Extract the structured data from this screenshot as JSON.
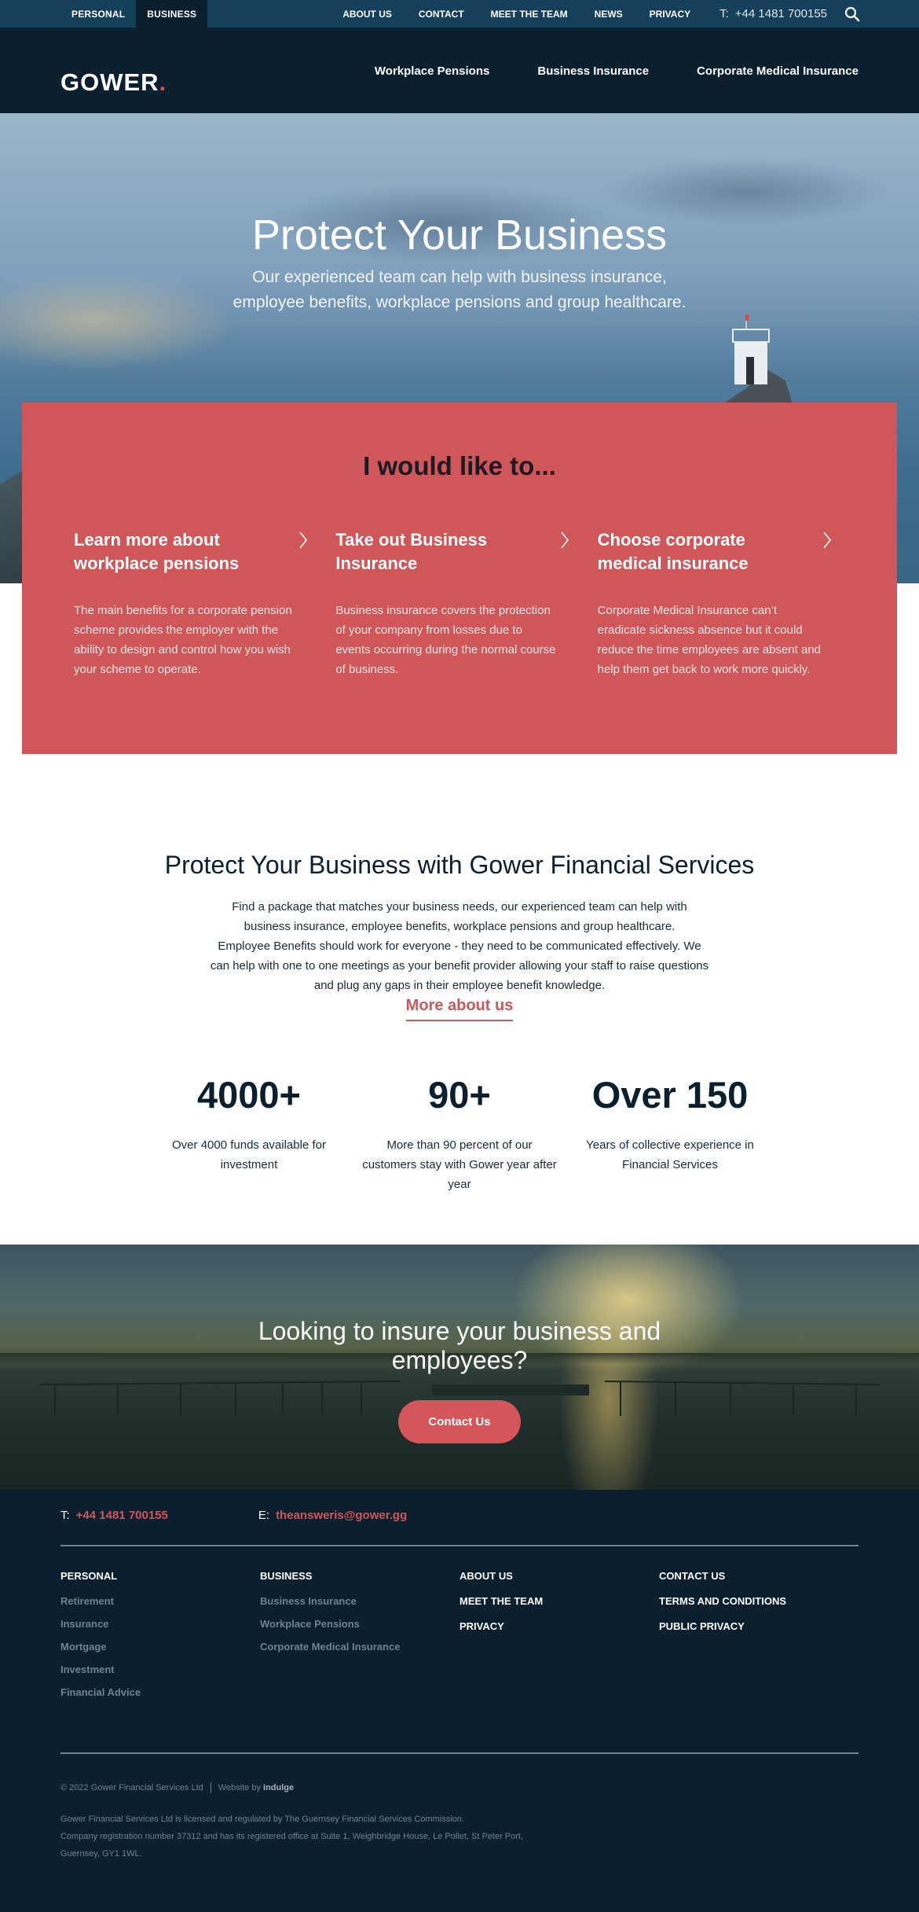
{
  "topbar": {
    "segments": [
      {
        "label": "PERSONAL",
        "active": false
      },
      {
        "label": "BUSINESS",
        "active": true
      }
    ],
    "links": [
      "ABOUT US",
      "CONTACT",
      "MEET THE TEAM",
      "NEWS",
      "PRIVACY"
    ],
    "phone_label": "T:",
    "phone": "+44 1481 700155",
    "search_icon": "search-icon"
  },
  "header": {
    "logo": "GOWER",
    "logo_dot": ".",
    "nav": [
      "Workplace Pensions",
      "Business Insurance",
      "Corporate Medical Insurance"
    ]
  },
  "hero": {
    "title": "Protect Your Business",
    "subtitle_line1": "Our experienced team can help with business insurance,",
    "subtitle_line2": "employee benefits, workplace pensions and group healthcare."
  },
  "panel": {
    "title": "I would like to...",
    "cards": [
      {
        "title": "Learn more about workplace pensions",
        "body": "The main benefits for a corporate pension scheme provides the employer with the ability to design and control how you wish your scheme to operate.",
        "icon": "chevron-right-icon"
      },
      {
        "title": "Take out Business Insurance",
        "body": "Business insurance covers the protection of your company from losses due to events occurring during the normal course of business.",
        "icon": "chevron-right-icon"
      },
      {
        "title": "Choose corporate medical insurance",
        "body": "Corporate Medical Insurance can’t eradicate sickness absence but it could reduce the time employees are absent and help them get back to work more quickly.",
        "icon": "chevron-right-icon"
      }
    ]
  },
  "intro": {
    "heading": "Protect Your Business with Gower Financial Services",
    "para1": "Find a package that matches your business needs, our experienced team can help with business insurance, employee benefits, workplace pensions and group healthcare.",
    "para2": "Employee Benefits should work for everyone - they need to be communicated effectively. We can help with one to one meetings as your benefit provider allowing your staff to raise questions and plug any gaps in their employee benefit knowledge.",
    "link": "More about us"
  },
  "stats": [
    {
      "value": "4000+",
      "desc": "Over 4000 funds available for investment"
    },
    {
      "value": "90+",
      "desc": "More than 90 percent of our customers stay with Gower year after year"
    },
    {
      "value": "Over 150",
      "desc": "Years of collective experience in Financial Services"
    }
  ],
  "cta": {
    "line1": "Looking to insure your business and",
    "line2": "employees?",
    "button": "Contact Us"
  },
  "footer": {
    "phone_label": "T:",
    "phone": "+44 1481 700155",
    "email_label": "E:",
    "email": "theansweris@gower.gg",
    "columns": [
      {
        "heading": "PERSONAL",
        "links": [
          "Retirement",
          "Insurance",
          "Mortgage",
          "Investment",
          "Financial Advice"
        ]
      },
      {
        "heading": "BUSINESS",
        "links": [
          "Business Insurance",
          "Workplace Pensions",
          "Corporate Medical Insurance"
        ]
      },
      {
        "heading": "ABOUT US",
        "links": [
          "MEET THE TEAM",
          "PRIVACY"
        ]
      },
      {
        "heading": "CONTACT US",
        "links": [
          "TERMS AND CONDITIONS",
          "PUBLIC PRIVACY"
        ]
      }
    ],
    "copyright": "© 2022 Gower Financial Services Ltd",
    "website_by": "Website by",
    "agency": "Indulge",
    "legal_line1": "Gower Financial Services Ltd is licensed and regulated by The Guernsey Financial Services Commission.",
    "legal_line2": "Company registration number 37312 and has its registered office at Suite 1, Weighbridge House, Le Pollet, St Peter Port,",
    "legal_line3": "Guernsey, GY1 1WL."
  },
  "colors": {
    "topbar": "#16405a",
    "navy": "#0b1f2e",
    "accent_red": "#cf5659",
    "link_red": "#c75a5e"
  }
}
